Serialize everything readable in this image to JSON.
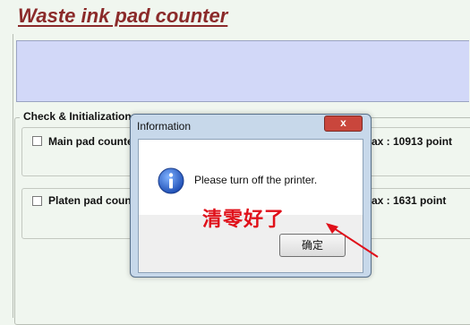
{
  "app": {
    "title": "Waste ink pad counter"
  },
  "group": {
    "label": "Check & Initialization"
  },
  "rows": [
    {
      "label": "Main pad counter",
      "max": "ax : 10913 point"
    },
    {
      "label": "Platen pad counter",
      "max": "ax : 1631 point"
    }
  ],
  "dialog": {
    "title": "Information",
    "close_label": "x",
    "message": "Please turn off the printer.",
    "ok_label": "确定",
    "icon": "info-icon"
  },
  "annotation": {
    "text": "清零好了",
    "color": "#e0101a"
  },
  "colors": {
    "title": "#8b2a2a",
    "panel": "#d2d8f8",
    "background": "#f0f6ef"
  }
}
